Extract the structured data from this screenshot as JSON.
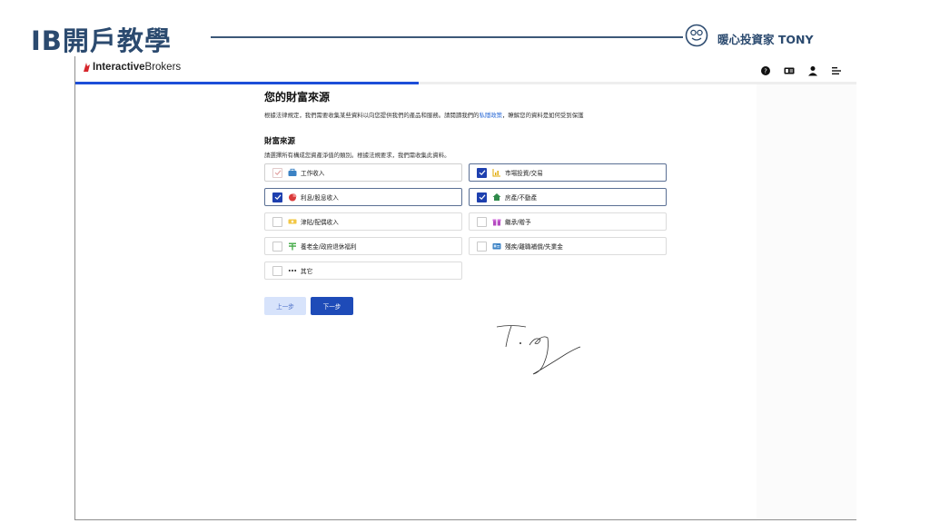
{
  "slide": {
    "title": "IB開戶教學",
    "brand_name": "暖心投資家 TONY",
    "signature_text": "Tony"
  },
  "app": {
    "logo_bold": "Interactive",
    "logo_regular": "Brokers",
    "progress_fraction": 0.44,
    "top_icons": [
      "help-icon",
      "id-card-icon",
      "user-icon",
      "menu-icon"
    ]
  },
  "page": {
    "title": "您的財富來源",
    "legal_prefix": "根據法律規定，我們需要收集某些資料以向您提供我們的產品和服務。請閱讀我們的",
    "privacy_link": "私隱政策",
    "legal_suffix": "，瞭解您的資料是如何受到保護",
    "section_title": "財富來源",
    "section_desc": "請選擇所有構成您資產淨值的類別。根據法規要求，我們需收集此資料。"
  },
  "options": [
    {
      "label": "工作收入",
      "checked": true,
      "icon": "briefcase-icon",
      "faded": true
    },
    {
      "label": "市場投資/交易",
      "checked": true,
      "icon": "chart-icon"
    },
    {
      "label": "利息/股息收入",
      "checked": true,
      "icon": "pie-chart-icon"
    },
    {
      "label": "房產/不動產",
      "checked": true,
      "icon": "house-icon"
    },
    {
      "label": "津貼/配偶收入",
      "checked": false,
      "icon": "money-icon"
    },
    {
      "label": "繼承/贈予",
      "checked": false,
      "icon": "gift-icon"
    },
    {
      "label": "養老金/政府退休福利",
      "checked": false,
      "icon": "pension-icon"
    },
    {
      "label": "殘疾/離職補償/失業金",
      "checked": false,
      "icon": "card-icon"
    },
    {
      "label": "其它",
      "checked": false,
      "icon": "more-icon"
    }
  ],
  "buttons": {
    "prev": "上一步",
    "next": "下一步"
  },
  "colors": {
    "accent": "#1e40af",
    "slide_title": "#2b4a6f",
    "link": "#2c6bd6"
  }
}
